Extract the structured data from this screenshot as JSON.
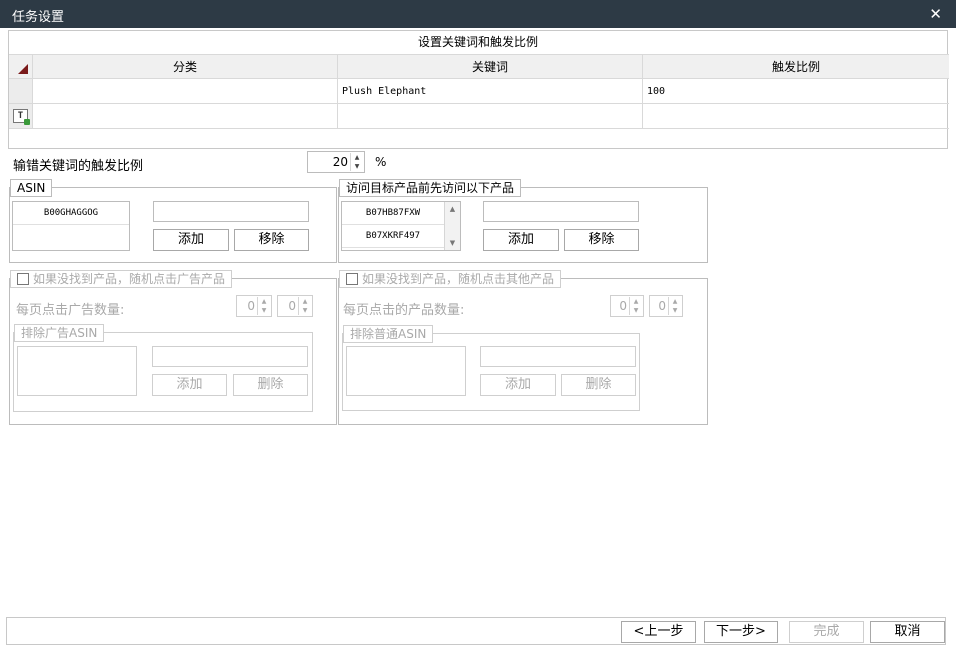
{
  "window": {
    "title": "任务设置",
    "close_glyph": "✕"
  },
  "keyword_grid": {
    "caption": "设置关键词和触发比例",
    "columns": [
      "分类",
      "关键词",
      "触发比例"
    ],
    "rows": [
      {
        "category": "",
        "keyword": "Plush Elephant",
        "ratio": "100"
      }
    ],
    "new_row_icon_text": "T"
  },
  "wrong_keyword": {
    "label": "输错关键词的触发比例",
    "value": "20",
    "unit": "%"
  },
  "asin": {
    "legend": "ASIN",
    "items": [
      "B00GHAGGOG"
    ],
    "add_label": "添加",
    "remove_label": "移除"
  },
  "visit_before": {
    "legend": "访问目标产品前先访问以下产品",
    "items": [
      "B07HB87FXW",
      "B07XKRF497"
    ],
    "add_label": "添加",
    "remove_label": "移除"
  },
  "ad_fallback": {
    "checkbox_label": "如果没找到产品，随机点击广告产品",
    "count_label": "每页点击广告数量:",
    "min_value": "0",
    "max_value": "0",
    "exclude_legend": "排除广告ASIN",
    "add_label": "添加",
    "delete_label": "删除"
  },
  "other_fallback": {
    "checkbox_label": "如果没找到产品，随机点击其他产品",
    "count_label": "每页点击的产品数量:",
    "min_value": "0",
    "max_value": "0",
    "exclude_legend": "排除普通ASIN",
    "add_label": "添加",
    "delete_label": "删除"
  },
  "footer": {
    "prev_label": "<上一步",
    "next_label": "下一步>",
    "finish_label": "完成",
    "cancel_label": "取消"
  }
}
